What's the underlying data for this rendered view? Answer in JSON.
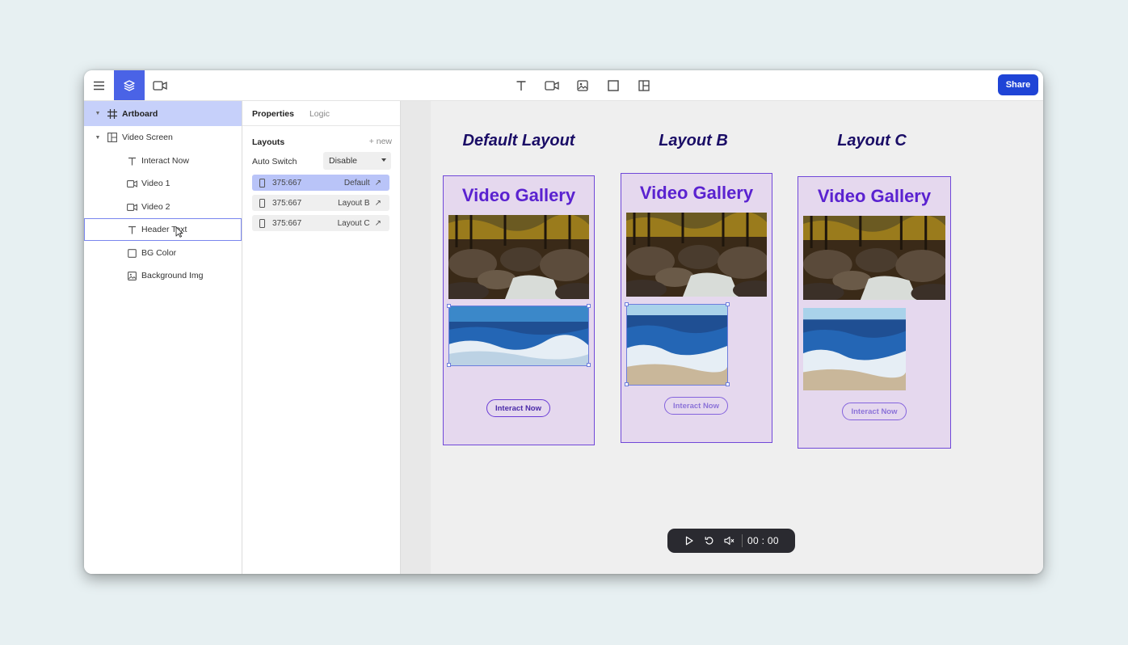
{
  "topbar": {
    "share_label": "Share",
    "left_icons": [
      "menu-icon",
      "layers-icon",
      "video-media-icon"
    ],
    "tools": [
      "text-tool-icon",
      "video-tool-icon",
      "image-tool-icon",
      "rectangle-tool-icon",
      "layout-tool-icon"
    ],
    "accent_color": "#4a63e6",
    "share_color": "#1f44d6"
  },
  "layers": {
    "artboard": "Artboard",
    "video_screen": "Video Screen",
    "items": [
      {
        "label": "Interact Now",
        "icon": "text-icon"
      },
      {
        "label": "Video 1",
        "icon": "video-icon"
      },
      {
        "label": "Video 2",
        "icon": "video-icon"
      },
      {
        "label": "Header Text",
        "icon": "text-icon"
      },
      {
        "label": "BG Color",
        "icon": "square-icon"
      },
      {
        "label": "Background Img",
        "icon": "image-icon"
      }
    ]
  },
  "properties": {
    "tab_properties": "Properties",
    "tab_logic": "Logic",
    "layouts_title": "Layouts",
    "new_label": "+ new",
    "auto_switch_label": "Auto Switch",
    "auto_switch_value": "Disable",
    "layouts": [
      {
        "size": "375:667",
        "name": "Default"
      },
      {
        "size": "375:667",
        "name": "Layout B"
      },
      {
        "size": "375:667",
        "name": "Layout C"
      }
    ]
  },
  "canvas": {
    "titles": [
      "Default Layout",
      "Layout B",
      "Layout C"
    ],
    "frame_title": "Video Gallery",
    "button_label": "Interact Now"
  },
  "playback": {
    "time": "00 : 00"
  }
}
